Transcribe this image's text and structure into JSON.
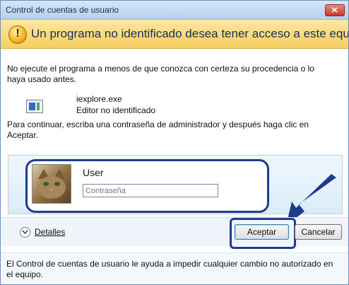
{
  "window": {
    "title": "Control de cuentas de usuario"
  },
  "warning": {
    "icon": "shield-warning-icon",
    "heading": "Un programa no identificado desea tener acceso a este equipo"
  },
  "body": {
    "intro_line1": "No ejecute el programa a menos de que conozca con certeza su procedencia o lo",
    "intro_line2": "haya usado antes.",
    "program_name": "iexplore.exe",
    "publisher": "Editor no identificado",
    "instruction_line1": "Para continuar, escriba una contraseña de administrador y después haga clic en",
    "instruction_line2": "Aceptar."
  },
  "credentials": {
    "user_name": "User",
    "password_placeholder": "Contraseña"
  },
  "details": {
    "label": "Detalles"
  },
  "buttons": {
    "ok": "Aceptar",
    "cancel": "Cancelar"
  },
  "footer": {
    "line1": "El Control de cuentas de usuario le ayuda a impedir cualquier cambio no autorizado en",
    "line2": "el equipo."
  },
  "colors": {
    "annotation_blue": "#1f3b8c",
    "warning_band": "#f7cf5d"
  }
}
